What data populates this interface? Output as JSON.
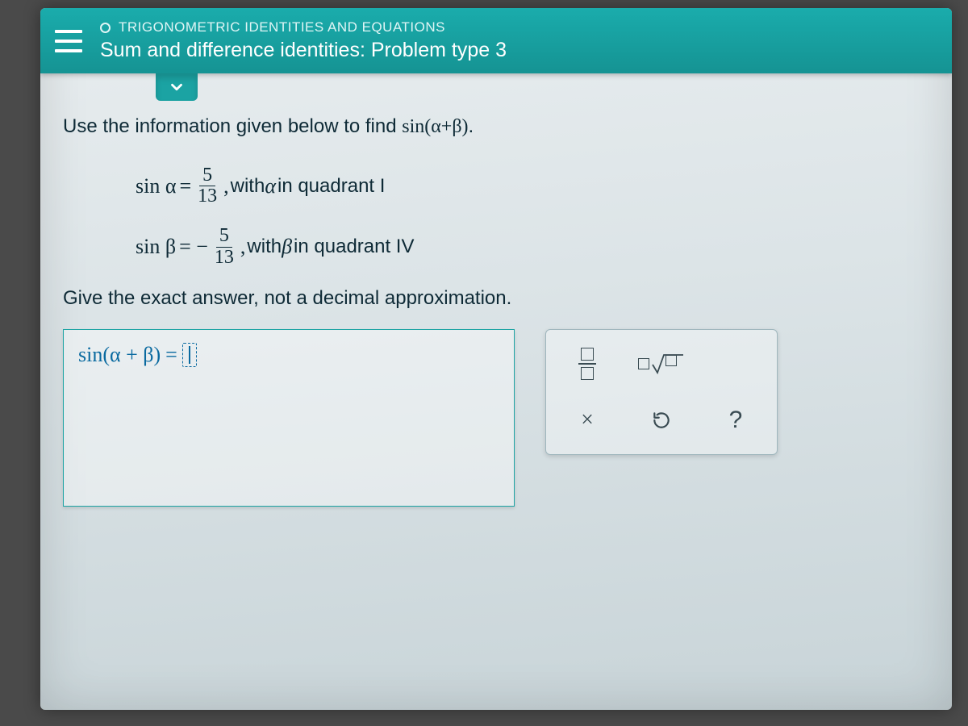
{
  "header": {
    "category": "TRIGONOMETRIC IDENTITIES AND EQUATIONS",
    "title": "Sum and difference identities: Problem type 3"
  },
  "problem": {
    "instruction_prefix": "Use the information given below to find ",
    "target_expr": "sin(α+β)",
    "period": ".",
    "line1": {
      "func": "sin α",
      "eq": "=",
      "num": "5",
      "den": "13",
      "comma": ",",
      "text1": " with ",
      "var": "α",
      "text2": " in quadrant I"
    },
    "line2": {
      "func": "sin β",
      "eq": "= −",
      "num": "5",
      "den": "13",
      "comma": ",",
      "text1": " with ",
      "var": "β",
      "text2": " in quadrant IV"
    },
    "exact": "Give the exact answer, not a decimal approximation."
  },
  "answer": {
    "lhs": "sin(α + β)",
    "eq": " = "
  },
  "toolbox": {
    "fraction": "fraction",
    "sqrt": "square-root",
    "clear": "×",
    "reset": "↺",
    "help": "?"
  }
}
